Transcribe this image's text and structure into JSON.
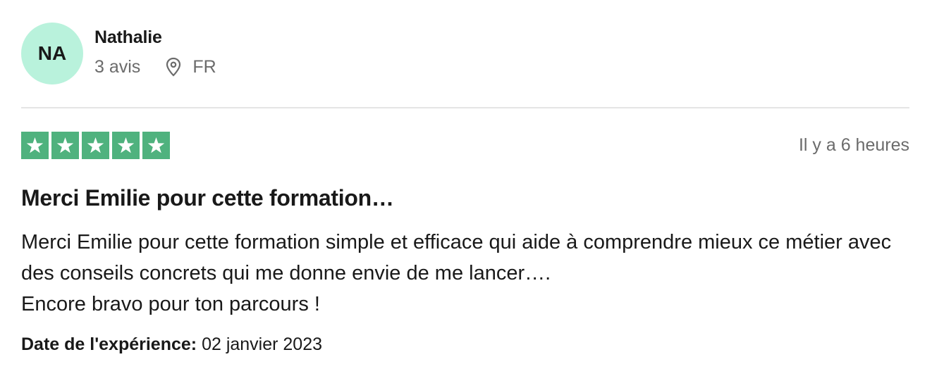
{
  "user": {
    "initials": "NA",
    "name": "Nathalie",
    "reviews_count": "3 avis",
    "country": "FR",
    "avatar_color": "#b9f2dc"
  },
  "review": {
    "rating": 5,
    "max_rating": 5,
    "star_color": "#4fb27e",
    "relative_date": "Il y a 6 heures",
    "title": "Merci Emilie pour cette formation…",
    "body_lines": [
      "Merci Emilie pour cette formation simple et efficace qui aide à comprendre mieux ce métier avec des conseils concrets qui me donne envie de me lancer….",
      "Encore bravo pour ton parcours !"
    ],
    "experience_label": "Date de l'expérience:",
    "experience_date": "02 janvier 2023"
  },
  "icons": {
    "location": "map-pin-icon",
    "star": "star-icon"
  }
}
